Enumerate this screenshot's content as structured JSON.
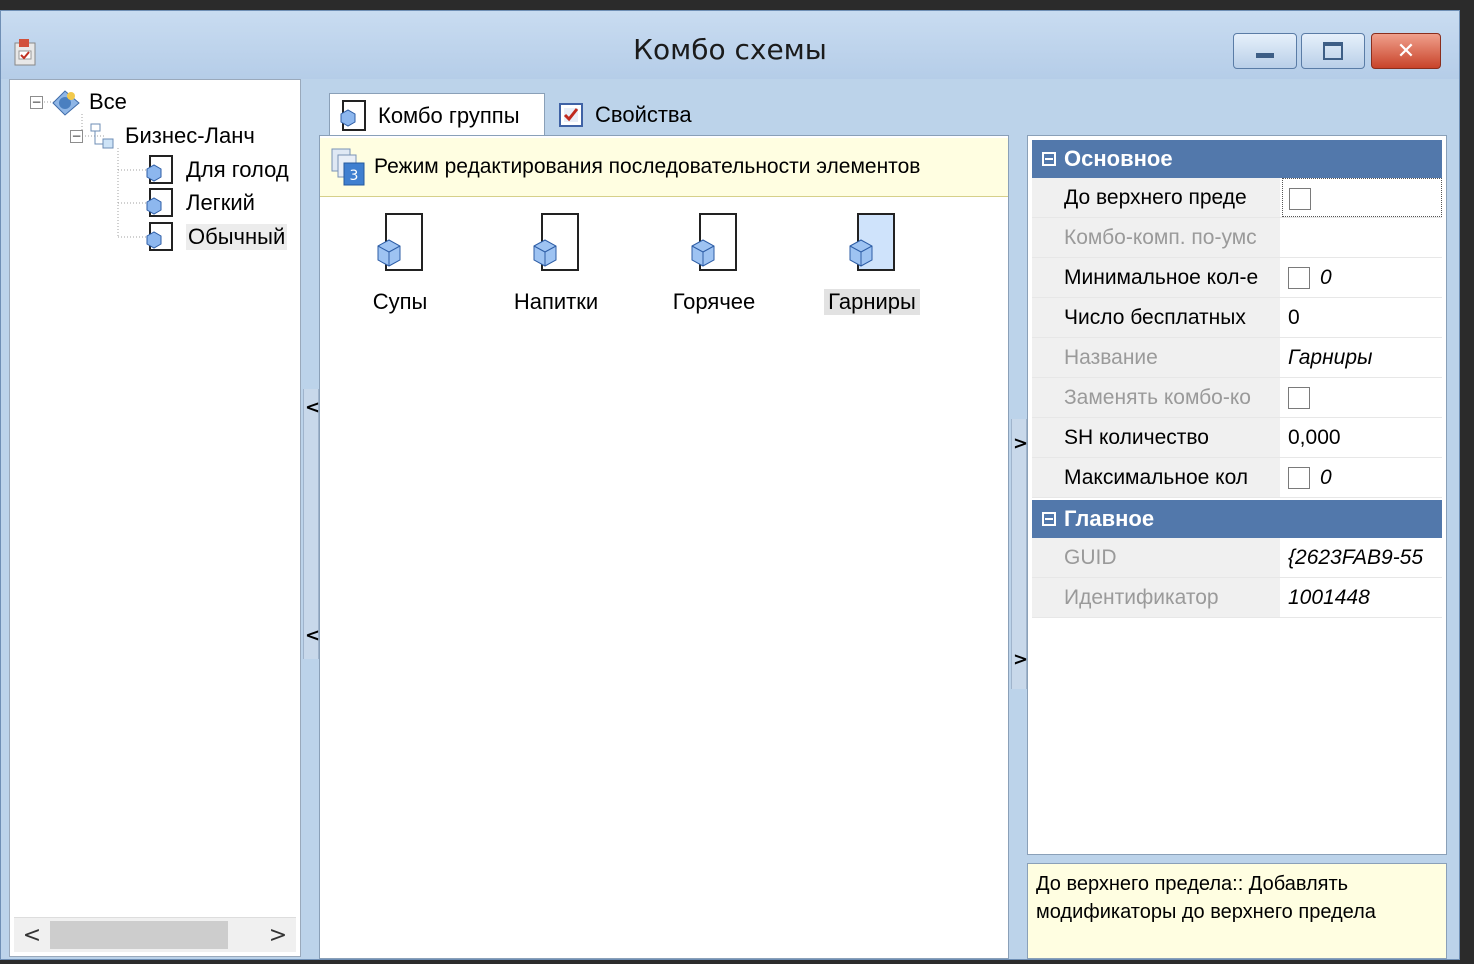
{
  "window": {
    "title": "Комбо схемы",
    "minimize_icon": "minimize-icon",
    "maximize_icon": "maximize-icon",
    "close_label": "✕"
  },
  "tree": {
    "nodes": [
      {
        "label": "Все",
        "icon": "globe-icon"
      },
      {
        "label": "Бизнес-Ланч",
        "icon": "folder-tree-icon"
      },
      {
        "label": "Для голод",
        "icon": "combo-group-icon"
      },
      {
        "label": "Легкий",
        "icon": "combo-group-icon"
      },
      {
        "label": "Обычный",
        "icon": "combo-group-icon"
      }
    ],
    "scroll_left": "<",
    "scroll_right": ">"
  },
  "splitters": {
    "left": "<",
    "right": ">"
  },
  "tabs": [
    {
      "label": "Комбо группы",
      "active": true
    },
    {
      "label": "Свойства",
      "active": false
    }
  ],
  "edit_mode": {
    "text": "Режим редактирования последовательности элементов",
    "badge": "3"
  },
  "groups": [
    {
      "label": "Супы"
    },
    {
      "label": "Напитки"
    },
    {
      "label": "Горячее"
    },
    {
      "label": "Гарниры",
      "selected": true
    }
  ],
  "property_grid": {
    "categories": [
      {
        "name": "Основное",
        "rows": [
          {
            "name": "До верхнего преде",
            "value": "",
            "checkbox": true,
            "readonly": false
          },
          {
            "name": "Комбо-комп. по-умс",
            "value": "",
            "checkbox": false,
            "readonly": true
          },
          {
            "name": "Минимальное кол-е",
            "value": "0",
            "checkbox": true,
            "readonly": false
          },
          {
            "name": "Число бесплатных",
            "value": "0",
            "checkbox": false,
            "readonly": false
          },
          {
            "name": "Название",
            "value": "Гарниры",
            "checkbox": false,
            "readonly": true
          },
          {
            "name": "Заменять комбо-ко",
            "value": "",
            "checkbox": true,
            "readonly": true
          },
          {
            "name": "SH количество",
            "value": "0,000",
            "checkbox": false,
            "readonly": false
          },
          {
            "name": "Максимальное кол",
            "value": "0",
            "checkbox": true,
            "readonly": false
          }
        ]
      },
      {
        "name": "Главное",
        "rows": [
          {
            "name": "GUID",
            "value": "{2623FAB9-55",
            "checkbox": false,
            "readonly": true
          },
          {
            "name": "Идентификатор",
            "value": "1001448",
            "checkbox": false,
            "readonly": true
          }
        ]
      }
    ]
  },
  "description": "До верхнего предела:: Добавлять модификаторы до верхнего предела",
  "colors": {
    "category_header": "#5278ab",
    "title_bar": "#bcd3ea",
    "info_bar": "#fffee1"
  }
}
